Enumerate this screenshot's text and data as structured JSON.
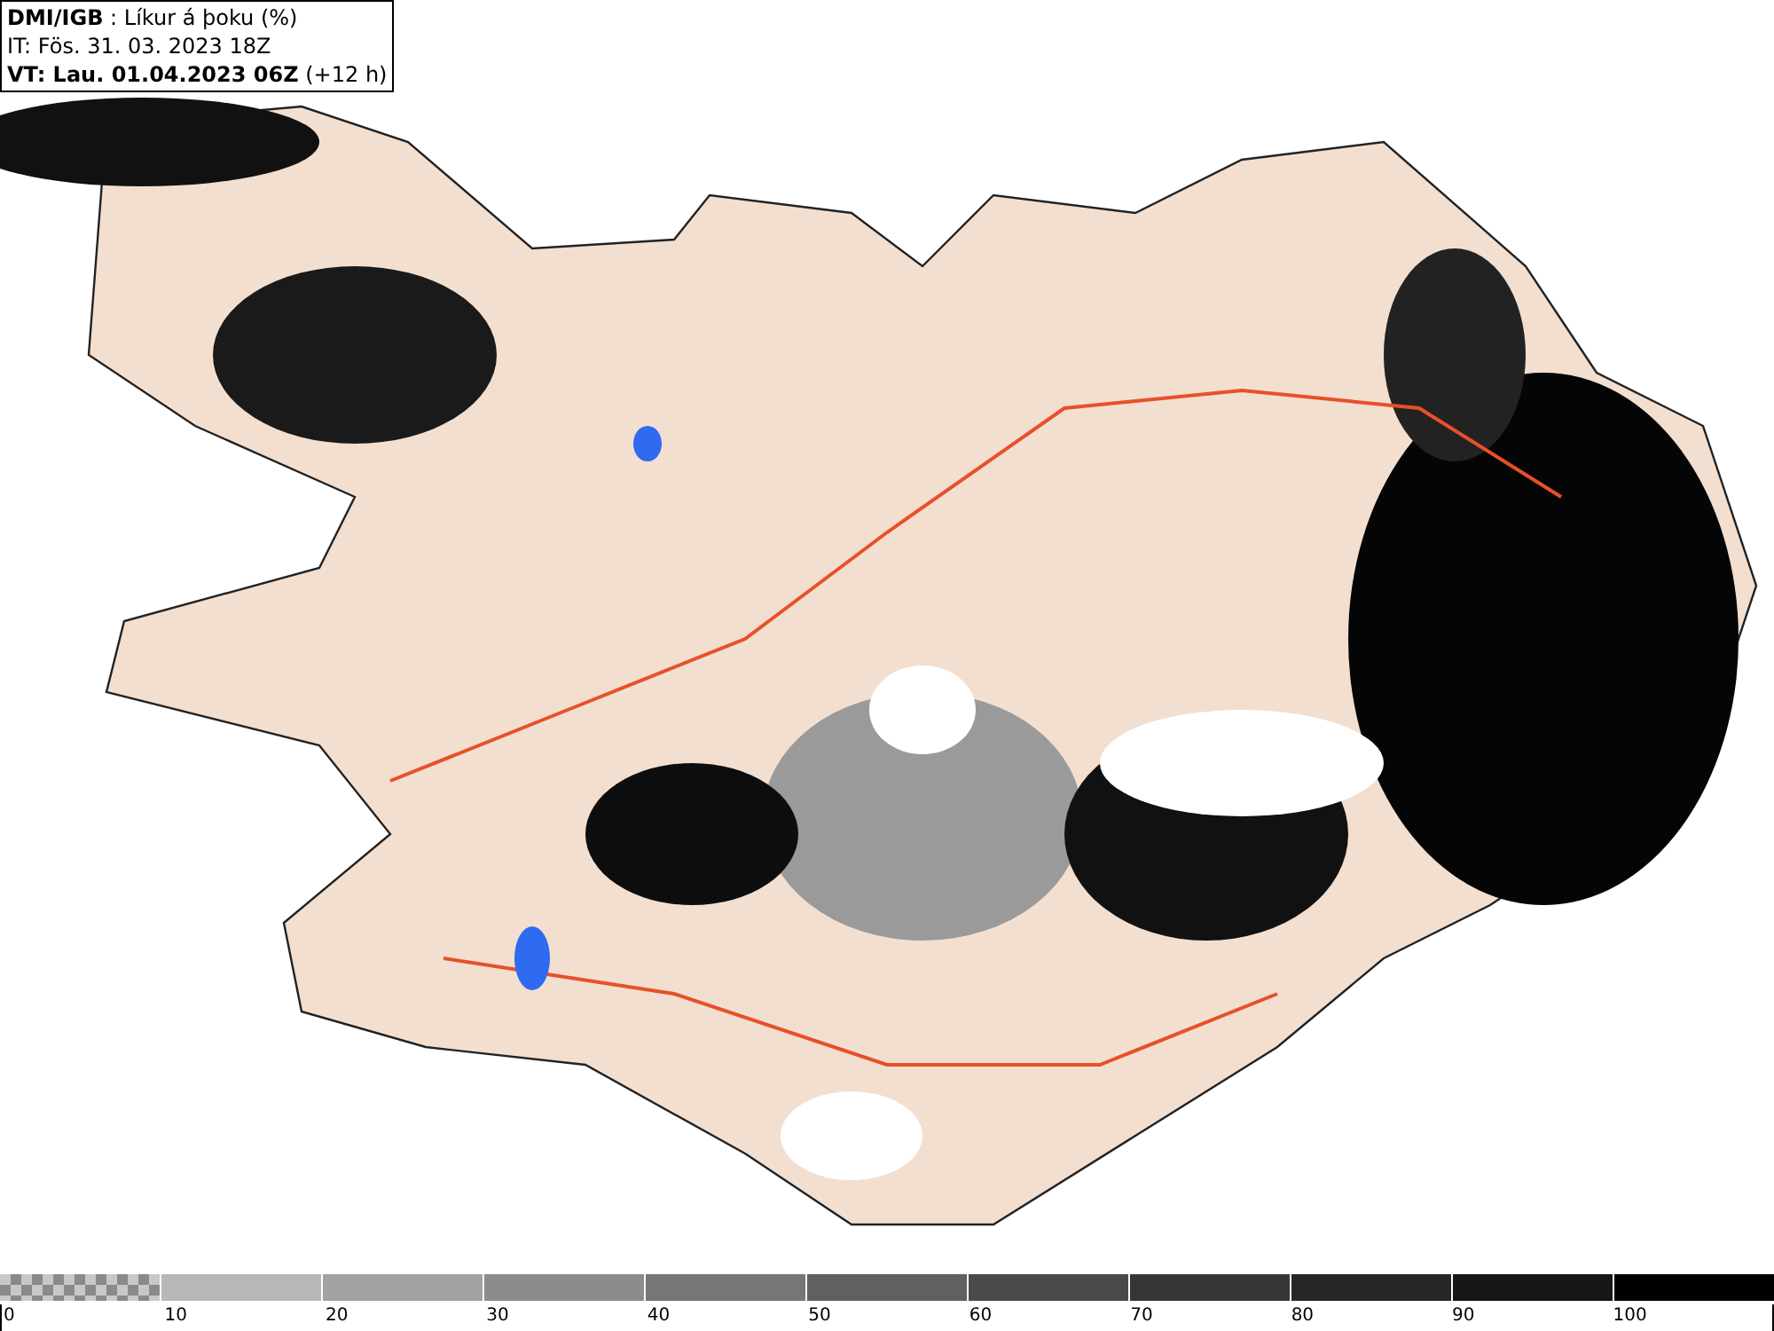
{
  "header": {
    "lines": [
      "**DMI/IGB** : Líkur á þoku (%)",
      "IT: Fös. 31. 03. 2023 18Z",
      "**VT: Lau. 01.04.2023 06Z** (+12 h)"
    ]
  },
  "legend": {
    "segments": [
      {
        "label": "0",
        "kind": "checker",
        "color": "#8a8a8a"
      },
      {
        "label": "10",
        "kind": "solid",
        "color": "#b8b8b8"
      },
      {
        "label": "20",
        "kind": "solid",
        "color": "#a2a2a2"
      },
      {
        "label": "30",
        "kind": "solid",
        "color": "#8c8c8c"
      },
      {
        "label": "40",
        "kind": "solid",
        "color": "#767676"
      },
      {
        "label": "50",
        "kind": "solid",
        "color": "#606060"
      },
      {
        "label": "60",
        "kind": "solid",
        "color": "#4a4a4a"
      },
      {
        "label": "70",
        "kind": "solid",
        "color": "#363636"
      },
      {
        "label": "80",
        "kind": "solid",
        "color": "#262626"
      },
      {
        "label": "90",
        "kind": "solid",
        "color": "#161616"
      },
      {
        "label": "100",
        "kind": "solid",
        "color": "#000000"
      }
    ]
  }
}
